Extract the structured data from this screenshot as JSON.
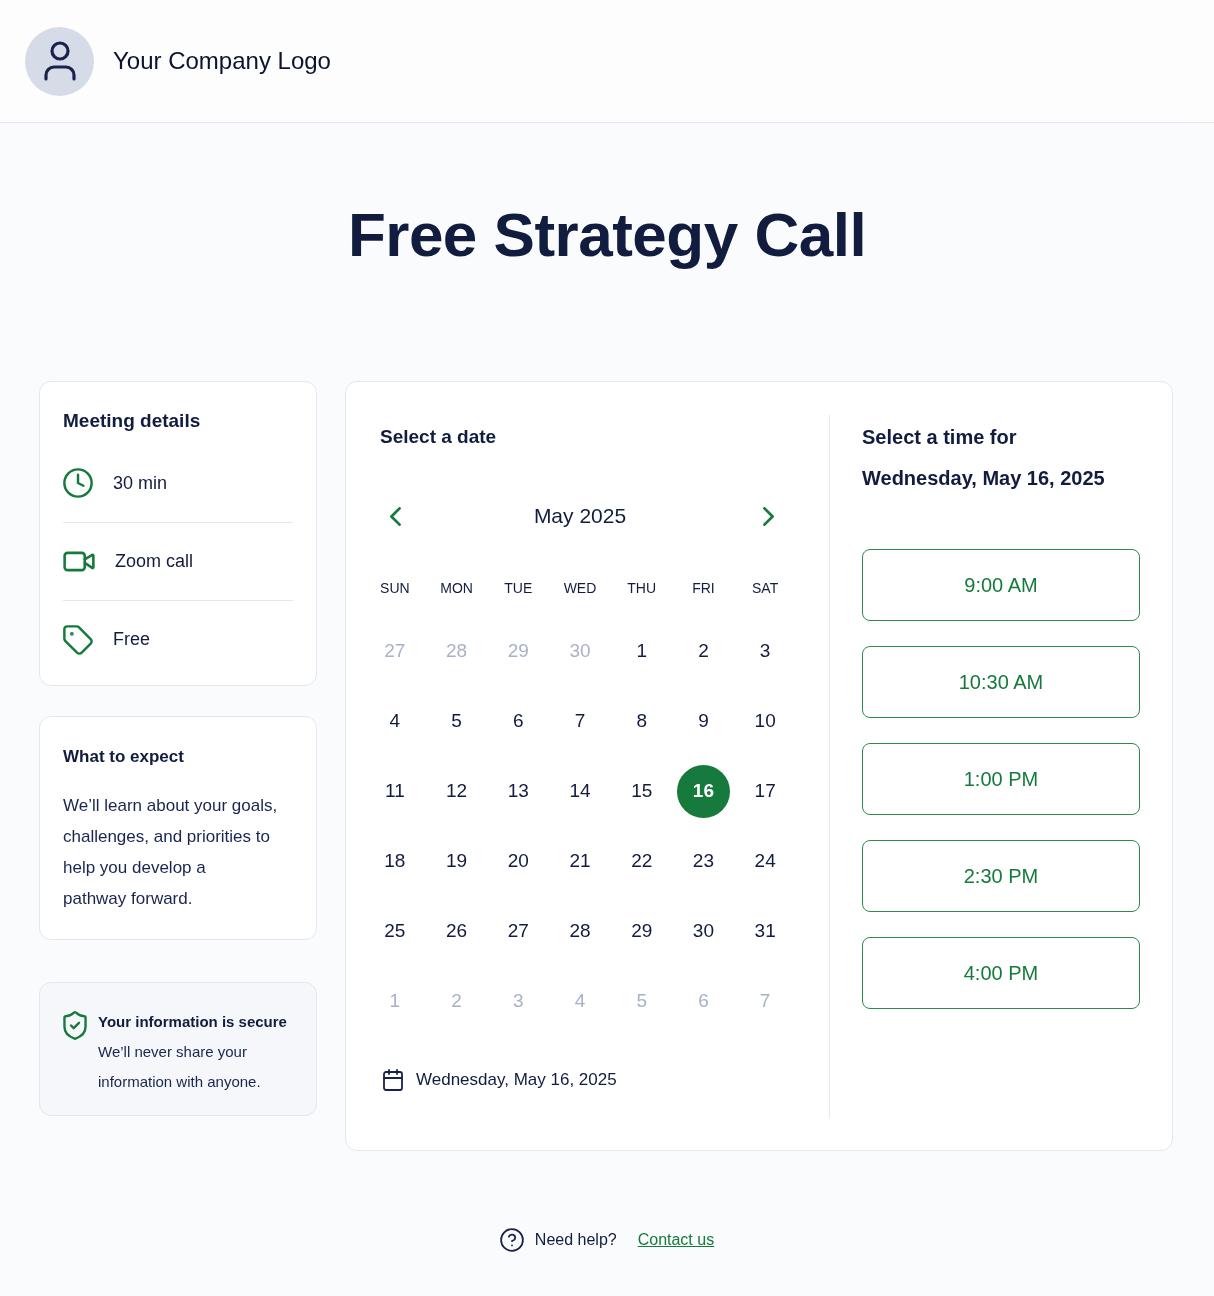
{
  "header": {
    "logo_text": "Your Company Logo"
  },
  "title": "Free Strategy Call",
  "meeting_details": {
    "title": "Meeting details",
    "items": [
      {
        "kind": "duration",
        "label": "30 min"
      },
      {
        "kind": "video",
        "label": "Zoom call"
      },
      {
        "kind": "price",
        "label": "Free"
      }
    ]
  },
  "what_to_expect": {
    "title": "What to expect",
    "text": "We’ll learn about your goals,\nchallenges, and priorities to\nhelp you develop a\npathway forward."
  },
  "security_note": {
    "title": "Your information is secure",
    "text": "We’ll never share your information with anyone."
  },
  "calendar": {
    "title": "Select a date",
    "month": "May 2025",
    "weekdays": [
      "SUN",
      "MON",
      "TUE",
      "WED",
      "THU",
      "FRI",
      "SAT"
    ],
    "weeks": [
      [
        {
          "label": "27",
          "outside_month": true,
          "selected": false
        },
        {
          "label": "28",
          "outside_month": true,
          "selected": false
        },
        {
          "label": "29",
          "outside_month": true,
          "selected": false
        },
        {
          "label": "30",
          "outside_month": true,
          "selected": false
        },
        {
          "label": "1",
          "outside_month": false,
          "selected": false
        },
        {
          "label": "2",
          "outside_month": false,
          "selected": false
        },
        {
          "label": "3",
          "outside_month": false,
          "selected": false
        }
      ],
      [
        {
          "label": "4",
          "outside_month": false,
          "selected": false
        },
        {
          "label": "5",
          "outside_month": false,
          "selected": false
        },
        {
          "label": "6",
          "outside_month": false,
          "selected": false
        },
        {
          "label": "7",
          "outside_month": false,
          "selected": false
        },
        {
          "label": "8",
          "outside_month": false,
          "selected": false
        },
        {
          "label": "9",
          "outside_month": false,
          "selected": false
        },
        {
          "label": "10",
          "outside_month": false,
          "selected": false
        }
      ],
      [
        {
          "label": "11",
          "outside_month": false,
          "selected": false
        },
        {
          "label": "12",
          "outside_month": false,
          "selected": false
        },
        {
          "label": "13",
          "outside_month": false,
          "selected": false
        },
        {
          "label": "14",
          "outside_month": false,
          "selected": false
        },
        {
          "label": "15",
          "outside_month": false,
          "selected": false
        },
        {
          "label": "16",
          "outside_month": false,
          "selected": true
        },
        {
          "label": "17",
          "outside_month": false,
          "selected": false
        }
      ],
      [
        {
          "label": "18",
          "outside_month": false,
          "selected": false
        },
        {
          "label": "19",
          "outside_month": false,
          "selected": false
        },
        {
          "label": "20",
          "outside_month": false,
          "selected": false
        },
        {
          "label": "21",
          "outside_month": false,
          "selected": false
        },
        {
          "label": "22",
          "outside_month": false,
          "selected": false
        },
        {
          "label": "23",
          "outside_month": false,
          "selected": false
        },
        {
          "label": "24",
          "outside_month": false,
          "selected": false
        }
      ],
      [
        {
          "label": "25",
          "outside_month": false,
          "selected": false
        },
        {
          "label": "26",
          "outside_month": false,
          "selected": false
        },
        {
          "label": "27",
          "outside_month": false,
          "selected": false
        },
        {
          "label": "28",
          "outside_month": false,
          "selected": false
        },
        {
          "label": "29",
          "outside_month": false,
          "selected": false
        },
        {
          "label": "30",
          "outside_month": false,
          "selected": false
        },
        {
          "label": "31",
          "outside_month": false,
          "selected": false
        }
      ],
      [
        {
          "label": "1",
          "outside_month": true,
          "selected": false
        },
        {
          "label": "2",
          "outside_month": true,
          "selected": false
        },
        {
          "label": "3",
          "outside_month": true,
          "selected": false
        },
        {
          "label": "4",
          "outside_month": true,
          "selected": false
        },
        {
          "label": "5",
          "outside_month": true,
          "selected": false
        },
        {
          "label": "6",
          "outside_month": true,
          "selected": false
        },
        {
          "label": "7",
          "outside_month": true,
          "selected": false
        }
      ]
    ],
    "selected_date": "Wednesday, May 16, 2025"
  },
  "times": {
    "title": "Select a time for",
    "date": "Wednesday, May 16, 2025",
    "slots": [
      {
        "label": "9:00 AM",
        "selected": false
      },
      {
        "label": "10:30 AM",
        "selected": false
      },
      {
        "label": "1:00 PM",
        "selected": false
      },
      {
        "label": "2:30 PM",
        "selected": false
      },
      {
        "label": "4:00 PM",
        "selected": false
      }
    ]
  },
  "footer": {
    "text": "Need help?",
    "link": "Contact us"
  }
}
